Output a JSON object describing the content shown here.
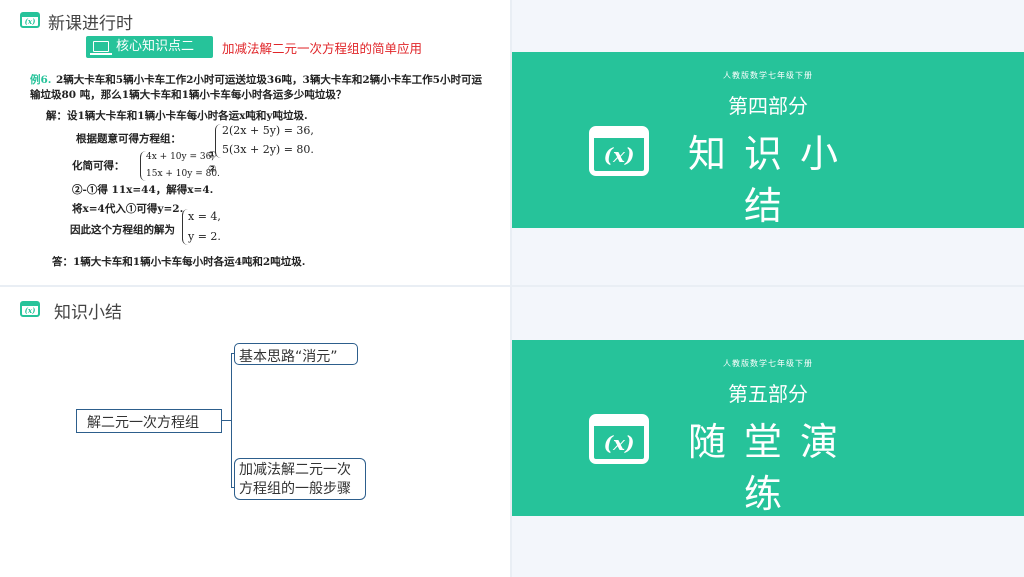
{
  "slide1": {
    "header_icon": "(x)",
    "header_title": "新课进行时",
    "badge_label": "核心知识点二",
    "badge_icon": "laptop-icon",
    "subtitle": "加减法解二元一次方程组的简单应用",
    "example_label": "例6.",
    "example_line1": "2辆大卡车和5辆小卡车工作2小时可运送垃圾36吨，3辆大卡车和2辆小卡车工作5小时可运",
    "example_line2": "输垃圾80 吨，那么1辆大卡车和1辆小卡车每小时各运多少吨垃圾？",
    "sol_intro": "解：设1辆大卡车和1辆小卡车每小时各运x吨和y吨垃圾.",
    "step1_label": "根据题意可得方程组：",
    "step1_eq1": "2(2x + 5y) = 36,",
    "step1_eq2": "5(3x + 2y) = 80.",
    "step2_label": "化简可得：",
    "step2_eq1": "4x + 10y = 36,",
    "step2_eq2": "15x + 10y = 80.",
    "mark1": "①",
    "mark2": "②",
    "step3": "②-①得      11x=44，解得x=4.",
    "step4": "将x=4代入①可得y=2.",
    "step5_label": "因此这个方程组的解为",
    "step5_eq1": "x = 4,",
    "step5_eq2": "y = 2.",
    "answer": "答：1辆大卡车和1辆小卡车每小时各运4吨和2吨垃圾."
  },
  "slide2": {
    "small_text": "人教版数学七年级下册",
    "part": "第四部分",
    "icon": "(x)",
    "title": "知识小结"
  },
  "slide3": {
    "header_icon": "(x)",
    "header_title": "知识小结",
    "root": "解二元一次方程组",
    "branch1": "基本思路“消元”",
    "branch2_line1": "加减法解二元一次",
    "branch2_line2": "方程组的一般步骤"
  },
  "slide4": {
    "small_text": "人教版数学七年级下册",
    "part": "第五部分",
    "icon": "(x)",
    "title": "随堂演练"
  },
  "colors": {
    "accent": "#26c39a",
    "highlight": "#e0262a",
    "mindmap_border": "#2d5e8c"
  }
}
